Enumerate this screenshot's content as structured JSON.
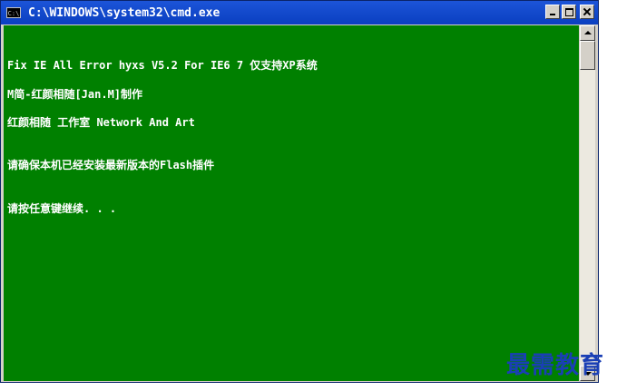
{
  "window": {
    "title": "C:\\WINDOWS\\system32\\cmd.exe",
    "icon_text": "C:\\"
  },
  "console": {
    "lines": [
      "Fix IE All Error hyxs V5.2 For IE6 7 仅支持XP系统",
      "M简-红颜相随[Jan.M]制作",
      "红颜相随 工作室 Network And Art",
      "请确保本机已经安装最新版本的Flash插件",
      "请按任意键继续. . ."
    ]
  },
  "watermark": "最需教育",
  "colors": {
    "console_bg": "#008000",
    "console_text": "#ffffff",
    "titlebar": "#0a3fc0"
  }
}
